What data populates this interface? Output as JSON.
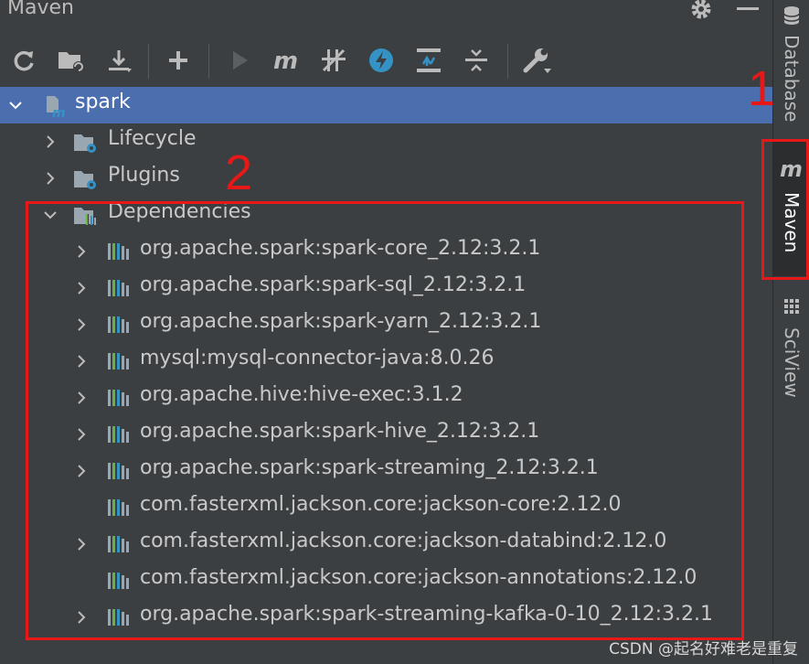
{
  "panel": {
    "title": "Maven"
  },
  "toolbar": {
    "buttons": [
      {
        "name": "reload-all-icon"
      },
      {
        "name": "generate-sources-icon"
      },
      {
        "name": "download-icon"
      },
      {
        "name": "add-icon"
      },
      {
        "name": "run-icon"
      },
      {
        "name": "execute-goal-icon"
      },
      {
        "name": "toggle-offline-icon"
      },
      {
        "name": "skip-tests-icon"
      },
      {
        "name": "show-dependencies-icon"
      },
      {
        "name": "collapse-all-icon"
      },
      {
        "name": "settings-wrench-icon"
      }
    ]
  },
  "tree": {
    "root": "spark",
    "lifecycle": "Lifecycle",
    "plugins": "Plugins",
    "dependencies": "Dependencies",
    "deps": [
      {
        "label": "org.apache.spark:spark-core_2.12:3.2.1",
        "expandable": true
      },
      {
        "label": "org.apache.spark:spark-sql_2.12:3.2.1",
        "expandable": true
      },
      {
        "label": "org.apache.spark:spark-yarn_2.12:3.2.1",
        "expandable": true
      },
      {
        "label": "mysql:mysql-connector-java:8.0.26",
        "expandable": true
      },
      {
        "label": "org.apache.hive:hive-exec:3.1.2",
        "expandable": true
      },
      {
        "label": "org.apache.spark:spark-hive_2.12:3.2.1",
        "expandable": true
      },
      {
        "label": "org.apache.spark:spark-streaming_2.12:3.2.1",
        "expandable": true
      },
      {
        "label": "com.fasterxml.jackson.core:jackson-core:2.12.0",
        "expandable": false
      },
      {
        "label": "com.fasterxml.jackson.core:jackson-databind:2.12.0",
        "expandable": true
      },
      {
        "label": "com.fasterxml.jackson.core:jackson-annotations:2.12.0",
        "expandable": false
      },
      {
        "label": "org.apache.spark:spark-streaming-kafka-0-10_2.12:3.2.1",
        "expandable": true
      }
    ]
  },
  "annotations": {
    "one": "1",
    "two": "2"
  },
  "sidebar": {
    "database": "Database",
    "maven": "Maven",
    "sciview": "SciView"
  },
  "watermark": "CSDN @起名好难老是重复",
  "colors": {
    "selection": "#4b6eaf",
    "annotation": "#e81818",
    "background": "#3c3f41"
  }
}
